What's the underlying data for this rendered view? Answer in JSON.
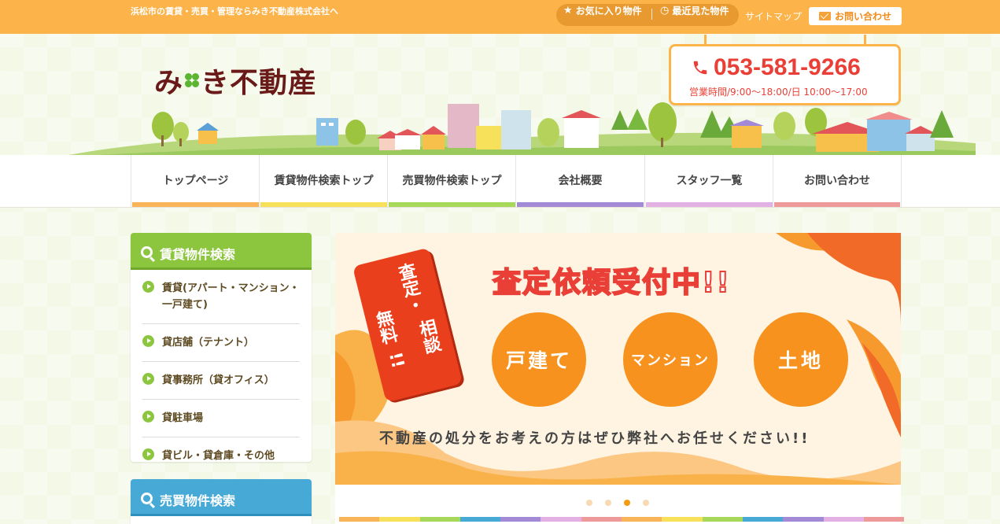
{
  "topbar": {
    "tagline": "浜松市の賃貸・売買・管理ならみき不動産株式会社へ",
    "favorites": "お気に入り物件",
    "recent": "最近見た物件",
    "sitemap": "サイトマップ",
    "contact": "お問い合わせ"
  },
  "header": {
    "logo_text_1": "み",
    "logo_text_2": "き不動産",
    "phone": "053-581-9266",
    "hours": "営業時間/9:00〜18:00/日 10:00〜17:00"
  },
  "nav": {
    "items": [
      {
        "label": "トップページ",
        "color": "#f9b45a"
      },
      {
        "label": "賃貸物件検索トップ",
        "color": "#f7e05a"
      },
      {
        "label": "売買物件検索トップ",
        "color": "#a8d85a"
      },
      {
        "label": "会社概要",
        "color": "#a38ad6"
      },
      {
        "label": "スタッフ一覧",
        "color": "#e3b0e3"
      },
      {
        "label": "お問い合わせ",
        "color": "#ef9a9a"
      }
    ]
  },
  "sidebar": {
    "rent": {
      "title": "賃貸物件検索",
      "color": "#8cc63e",
      "items": [
        "賃貸(アパート・マンション・一戸建て)",
        "貸店舗（テナント）",
        "貸事務所（貸オフィス）",
        "貸駐車場",
        "貸ビル・貸倉庫・その他"
      ]
    },
    "sale": {
      "title": "売買物件検索",
      "color": "#47a9d6"
    }
  },
  "slider": {
    "badge_line1": "査定・",
    "badge_line2": "無料",
    "badge_line3": "!!",
    "badge_line4": "相談",
    "headline": "査定依頼受付中!!",
    "circles": [
      "戸建て",
      "マンション",
      "土地"
    ],
    "footer": "不動産の処分をお考えの方はぜひ弊社へお任せください!!",
    "active_slide": 3,
    "slide_count": 4
  },
  "colors": {
    "accent": "#fcb34a",
    "phone": "#ea3f36",
    "circle": "#f7921e"
  },
  "icons": {
    "favorites": "star-icon",
    "recent": "clock-icon",
    "contact": "mail-icon",
    "phone": "phone-icon",
    "search": "search-icon"
  }
}
